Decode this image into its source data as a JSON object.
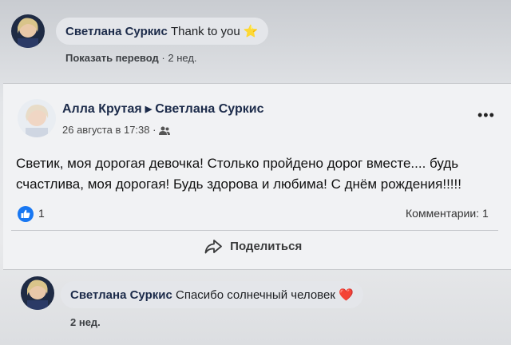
{
  "comment_top": {
    "author": "Светлана Суркис",
    "text": "Thank to you",
    "emoji": "⭐",
    "translate_label": "Показать перевод",
    "separator": "·",
    "time": "2 нед."
  },
  "post": {
    "author": "Алла Крутая",
    "target": "Светлана Суркис",
    "date": "26 августа в 17:38",
    "date_separator": "·",
    "audience_icon": "friends-icon",
    "body_line1": "Светик, моя дорогая девочка! Столько пройдено дорог вместе.... будь",
    "body_line2": "счастлива, моя дорогая! Будь здорова и любима! С днём рождения!!!!!",
    "more_label": "•••",
    "like_count": "1",
    "comments_label": "Комментарии: 1",
    "share_label": "Поделиться"
  },
  "comment_bottom": {
    "author": "Светлана Суркис",
    "text": "Спасибо солнечный человек",
    "emoji": "❤️",
    "time": "2 нед."
  },
  "colors": {
    "accent": "#1877f2",
    "name_color": "#1c2b4a",
    "bubble_bg": "#e4e6ea",
    "heart": "#e8334a",
    "star": "#f6c12b"
  }
}
